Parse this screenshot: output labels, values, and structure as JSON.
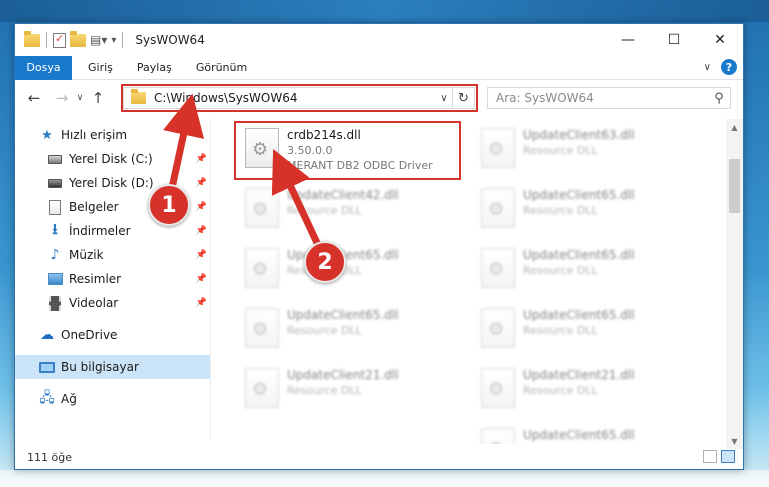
{
  "window": {
    "title": "SysWOW64"
  },
  "ribbon": {
    "tabs": [
      "Dosya",
      "Giriş",
      "Paylaş",
      "Görünüm"
    ]
  },
  "nav": {
    "address": "C:\\Windows\\SysWOW64",
    "search_placeholder": "Ara: SysWOW64"
  },
  "sidebar": {
    "items": [
      {
        "label": "Hızlı erişim",
        "icon": "star-icon"
      },
      {
        "label": "Yerel Disk (C:)",
        "icon": "disk-icon",
        "pinned": true
      },
      {
        "label": "Yerel Disk (D:)",
        "icon": "disk-icon",
        "pinned": true
      },
      {
        "label": "Belgeler",
        "icon": "documents-icon",
        "pinned": true
      },
      {
        "label": "İndirmeler",
        "icon": "downloads-icon",
        "pinned": true
      },
      {
        "label": "Müzik",
        "icon": "music-icon",
        "pinned": true
      },
      {
        "label": "Resimler",
        "icon": "pictures-icon",
        "pinned": true
      },
      {
        "label": "Videolar",
        "icon": "videos-icon",
        "pinned": true
      },
      {
        "label": "OneDrive",
        "icon": "onedrive-icon"
      },
      {
        "label": "Bu bilgisayar",
        "icon": "this-pc-icon",
        "selected": true
      },
      {
        "label": "Ağ",
        "icon": "network-icon"
      }
    ]
  },
  "files": {
    "highlighted": {
      "name": "crdb214s.dll",
      "version": "3.50.0.0",
      "description": "MERANT DB2 ODBC Driver"
    },
    "blurred": [
      {
        "name": "UpdateClient63.dll",
        "type": "Resource DLL"
      },
      {
        "name": "UpdateClient42.dll",
        "type": "Resource DLL"
      },
      {
        "name": "UpdateClient65.dll",
        "type": "Resource DLL"
      },
      {
        "name": "UpdateClient65.dll",
        "type": "Resource DLL"
      },
      {
        "name": "UpdateClient65.dll",
        "type": "Resource DLL"
      },
      {
        "name": "UpdateClient65.dll",
        "type": "Resource DLL"
      },
      {
        "name": "UpdateClient65.dll",
        "type": "Resource DLL"
      },
      {
        "name": "UpdateClient21.dll",
        "type": "Resource DLL"
      },
      {
        "name": "UpdateClient21.dll",
        "type": "Resource DLL"
      },
      {
        "name": "UpdateClient65.dll",
        "type": "Resource DLL"
      }
    ]
  },
  "status": {
    "count": "111 öğe"
  },
  "callouts": {
    "step1": "1",
    "step2": "2"
  },
  "colors": {
    "accent": "#1979ca",
    "highlight": "#d6322a",
    "selected_bg": "#cce4f7"
  }
}
